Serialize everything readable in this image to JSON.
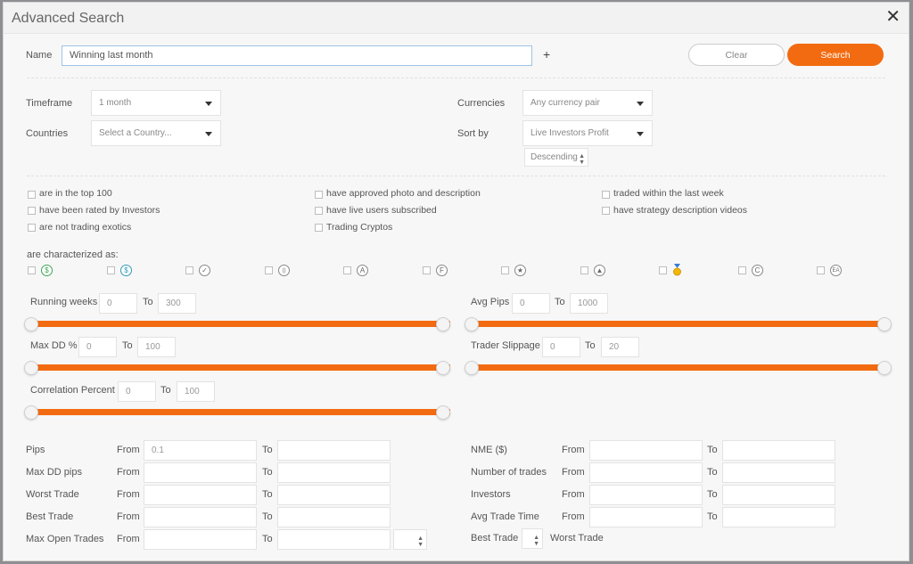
{
  "dialog": {
    "title": "Advanced Search",
    "close_glyph": "✕"
  },
  "name_row": {
    "label": "Name",
    "value": "Winning last month",
    "add_glyph": "+",
    "clear_label": "Clear",
    "search_label": "Search"
  },
  "filters": {
    "timeframe_label": "Timeframe",
    "timeframe_value": "1 month",
    "countries_label": "Countries",
    "countries_value": "Select a Country...",
    "currencies_label": "Currencies",
    "currencies_value": "Any currency pair",
    "sortby_label": "Sort by",
    "sortby_value": "Live Investors Profit",
    "order_value": "Descending"
  },
  "checkboxes": {
    "col1": [
      "are in the top 100",
      "have been rated by Investors",
      "are not trading exotics"
    ],
    "col2": [
      "have approved photo and description",
      "have live users subscribed",
      "Trading Cryptos"
    ],
    "col3": [
      "traded within the last week",
      "have strategy description videos"
    ]
  },
  "characterized": {
    "label": "are characterized as:",
    "icons": [
      "dollar-green-icon",
      "dollar-blue-icon",
      "check-badge-icon",
      "bracket-badge-icon",
      "letter-a-badge-icon",
      "letter-f-badge-icon",
      "star-badge-icon",
      "tree-badge-icon",
      "medal-icon",
      "letter-c-badge-icon",
      "ea-badge-icon"
    ],
    "glyphs": [
      "$",
      "$",
      "✓",
      "()",
      "A",
      "F",
      "★",
      "▲",
      "",
      "C",
      "EA"
    ]
  },
  "ranges": {
    "to_label": "To",
    "running_weeks": {
      "label": "Running weeks",
      "from": "0",
      "to": "300"
    },
    "avg_pips": {
      "label": "Avg Pips",
      "from": "0",
      "to": "1000"
    },
    "max_dd": {
      "label": "Max DD %",
      "from": "0",
      "to": "100"
    },
    "trader_slippage": {
      "label": "Trader Slippage",
      "from": "0",
      "to": "20"
    },
    "correlation": {
      "label": "Correlation Percent",
      "from": "0",
      "to": "100"
    }
  },
  "criteria": {
    "from_label": "From",
    "to_label": "To",
    "left": [
      {
        "label": "Pips",
        "from": "0.1",
        "to": ""
      },
      {
        "label": "Max DD pips",
        "from": "",
        "to": ""
      },
      {
        "label": "Worst Trade",
        "from": "",
        "to": ""
      },
      {
        "label": "Best Trade",
        "from": "",
        "to": ""
      },
      {
        "label": "Max Open Trades",
        "from": "",
        "to": ""
      }
    ],
    "right": [
      {
        "label": "NME ($)",
        "from": "",
        "to": ""
      },
      {
        "label": "Number of trades",
        "from": "",
        "to": ""
      },
      {
        "label": "Investors",
        "from": "",
        "to": ""
      },
      {
        "label": "Avg Trade Time",
        "from": "",
        "to": ""
      }
    ],
    "best_trade_label": "Best Trade",
    "worst_trade_label": "Worst Trade"
  },
  "colors": {
    "accent": "#f26b11",
    "focus_border": "#9ec3e6"
  }
}
